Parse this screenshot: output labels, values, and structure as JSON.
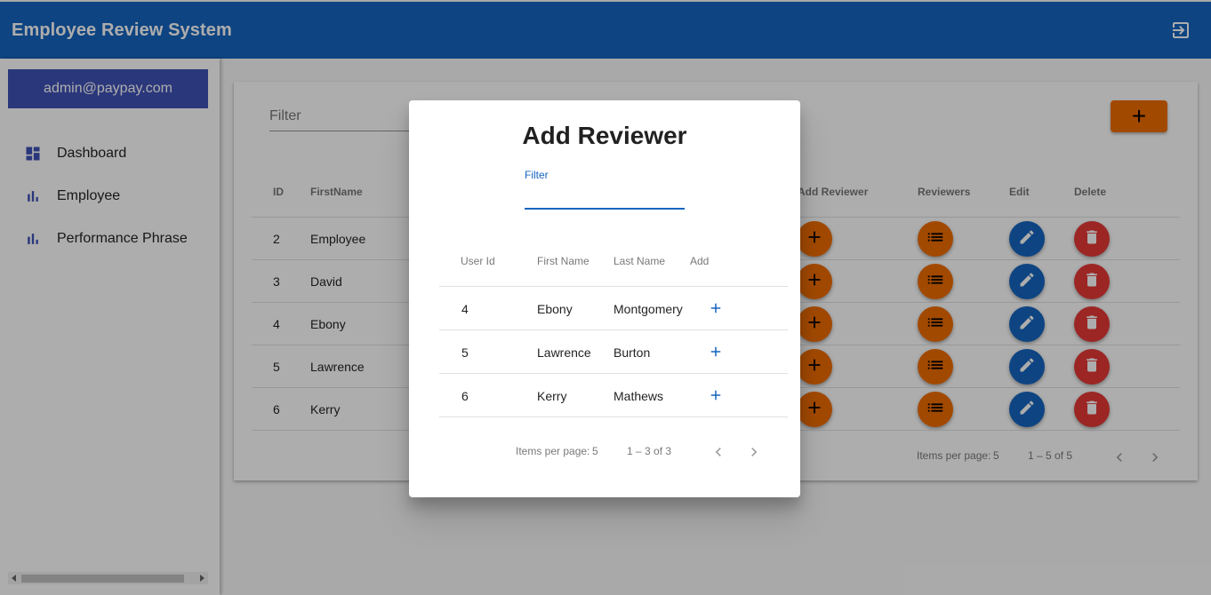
{
  "app": {
    "title": "Employee Review System"
  },
  "sidebar": {
    "user": "admin@paypay.com",
    "items": [
      {
        "label": "Dashboard",
        "icon": "dashboard-icon"
      },
      {
        "label": "Employee",
        "icon": "bar-chart-icon"
      },
      {
        "label": "Performance Phrase",
        "icon": "bar-chart-icon"
      }
    ]
  },
  "main": {
    "filter_placeholder": "Filter",
    "add_label": "+",
    "columns": [
      "ID",
      "FirstName",
      "Add Reviewer",
      "Reviewers",
      "Edit",
      "Delete"
    ],
    "rows": [
      {
        "id": "2",
        "first": "Employee"
      },
      {
        "id": "3",
        "first": "David"
      },
      {
        "id": "4",
        "first": "Ebony"
      },
      {
        "id": "5",
        "first": "Lawrence"
      },
      {
        "id": "6",
        "first": "Kerry"
      }
    ],
    "pager": {
      "items_label": "Items per page:",
      "page_size": "5",
      "range": "1 – 5 of 5"
    }
  },
  "dialog": {
    "title": "Add Reviewer",
    "filter_label": "Filter",
    "columns": [
      "User Id",
      "First Name",
      "Last Name",
      "Add"
    ],
    "rows": [
      {
        "id": "4",
        "first": "Ebony",
        "last": "Montgomery"
      },
      {
        "id": "5",
        "first": "Lawrence",
        "last": "Burton"
      },
      {
        "id": "6",
        "first": "Kerry",
        "last": "Mathews"
      }
    ],
    "pager": {
      "items_label": "Items per page:",
      "page_size": "5",
      "range": "1 – 3 of 3"
    }
  },
  "colors": {
    "primary": "#1565c0",
    "accent": "#ef6c00",
    "warn": "#e53935",
    "indigo": "#3f51b5"
  }
}
